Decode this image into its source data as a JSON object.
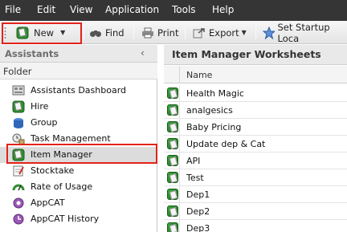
{
  "menubar": {
    "items": [
      "File",
      "Edit",
      "View",
      "Application",
      "Tools",
      "Help"
    ]
  },
  "toolbar": {
    "new_label": "New",
    "find_label": "Find",
    "print_label": "Print",
    "export_label": "Export",
    "startup_label": "Set Startup Loca"
  },
  "left_pane": {
    "title": "Assistants",
    "collapse_glyph": "‹",
    "folder_label": "Folder",
    "items": [
      {
        "label": "Assistants Dashboard",
        "icon": "dashboard-icon"
      },
      {
        "label": "Hire",
        "icon": "hire-icon"
      },
      {
        "label": "Group",
        "icon": "group-icon"
      },
      {
        "label": "Task Management",
        "icon": "task-icon"
      },
      {
        "label": "Item Manager",
        "icon": "item-manager-icon",
        "selected": true
      },
      {
        "label": "Stocktake",
        "icon": "stocktake-icon"
      },
      {
        "label": "Rate of Usage",
        "icon": "rate-icon"
      },
      {
        "label": "AppCAT",
        "icon": "appcat-icon"
      },
      {
        "label": "AppCAT History",
        "icon": "appcat-history-icon"
      }
    ]
  },
  "right_pane": {
    "title": "Item Manager Worksheets",
    "column_name": "Name",
    "rows": [
      "Health Magic",
      "analgesics",
      "Baby Pricing",
      "Update dep & Cat",
      "API",
      "Test",
      "Dep1",
      "Dep2",
      "Dep3"
    ]
  },
  "colors": {
    "menubar_bg": "#353535",
    "highlight": "#e2231a",
    "selection_bg": "#dcdcdc"
  }
}
